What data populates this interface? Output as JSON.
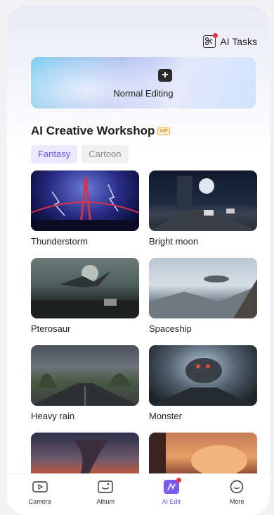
{
  "header": {
    "ai_tasks_label": "AI Tasks"
  },
  "banner": {
    "label": "Normal Editing"
  },
  "section": {
    "title": "AI Creative Workshop",
    "vip_badge": "VIP"
  },
  "chips": [
    {
      "label": "Fantasy",
      "active": true
    },
    {
      "label": "Cartoon",
      "active": false
    }
  ],
  "cards": [
    {
      "label": "Thunderstorm"
    },
    {
      "label": "Bright moon"
    },
    {
      "label": "Pterosaur"
    },
    {
      "label": "Spaceship"
    },
    {
      "label": "Heavy rain"
    },
    {
      "label": "Monster"
    },
    {
      "label": ""
    },
    {
      "label": ""
    }
  ],
  "tabs": [
    {
      "label": "Camera",
      "icon": "camera-icon",
      "active": false
    },
    {
      "label": "Album",
      "icon": "album-icon",
      "active": false
    },
    {
      "label": "AI Edit",
      "icon": "ai-edit-icon",
      "active": true
    },
    {
      "label": "More",
      "icon": "more-icon",
      "active": false
    }
  ],
  "colors": {
    "accent": "#6a52e8",
    "badge_dot": "#e8333a"
  }
}
